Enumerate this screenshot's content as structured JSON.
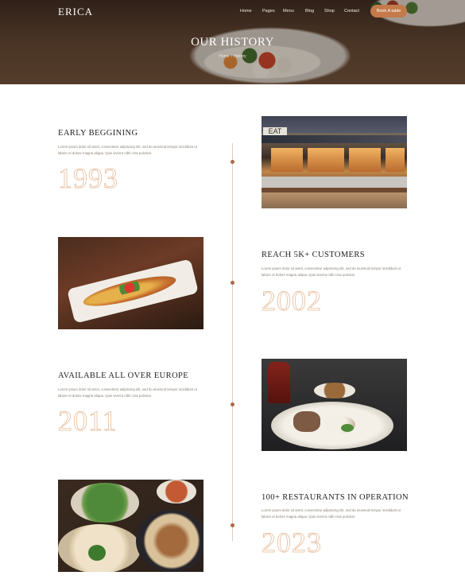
{
  "header": {
    "logo": "ERICA",
    "nav": [
      "Home",
      "Pages",
      "Menu",
      "Blog",
      "Shop",
      "Contact"
    ],
    "book_button": "Book A table"
  },
  "hero": {
    "title": "OUR HISTORY",
    "breadcrumb": [
      "Home",
      "/",
      "History"
    ]
  },
  "timeline": {
    "entries": [
      {
        "title": "EARLY BEGGINING",
        "body": "Lorem ipsum dolor sit amet, consectetur adipiscing elit, sed do eiusmod tempor incididunt ut labore et dolore magna aliqua. Quis viverra nibh cras pulvinar.",
        "year": "1993",
        "image": "restaurant-exterior-photo"
      },
      {
        "title": "REACH 5K+ CUSTOMERS",
        "body": "Lorem ipsum dolor sit amet, consectetur adipiscing elit, sed do eiusmod tempor incididunt ut labore et dolore magna aliqua. Quis viverra nibh cras pulvinar.",
        "year": "2002",
        "image": "plated-dish-photo"
      },
      {
        "title": "AVAILABLE ALL OVER EUROPE",
        "body": "Lorem ipsum dolor sit amet, consectetur adipiscing elit, sed do eiusmod tempor incididunt ut labore et dolore magna aliqua. Quis viverra nibh cras pulvinar.",
        "year": "2011",
        "image": "fine-dining-photo"
      },
      {
        "title": "100+ RESTAURANTS IN OPERATION",
        "body": "Lorem ipsum dolor sit amet, consectetur adipiscing elit, sed do eiusmod tempor incididunt ut labore et dolore magna aliqua. Quis viverra nibh cras pulvinar.",
        "year": "2023",
        "image": "dumplings-photo"
      }
    ]
  },
  "colors": {
    "accent": "#c47a4a",
    "timeline_dot": "#a86a48",
    "year_outline": "#e2b48c"
  }
}
